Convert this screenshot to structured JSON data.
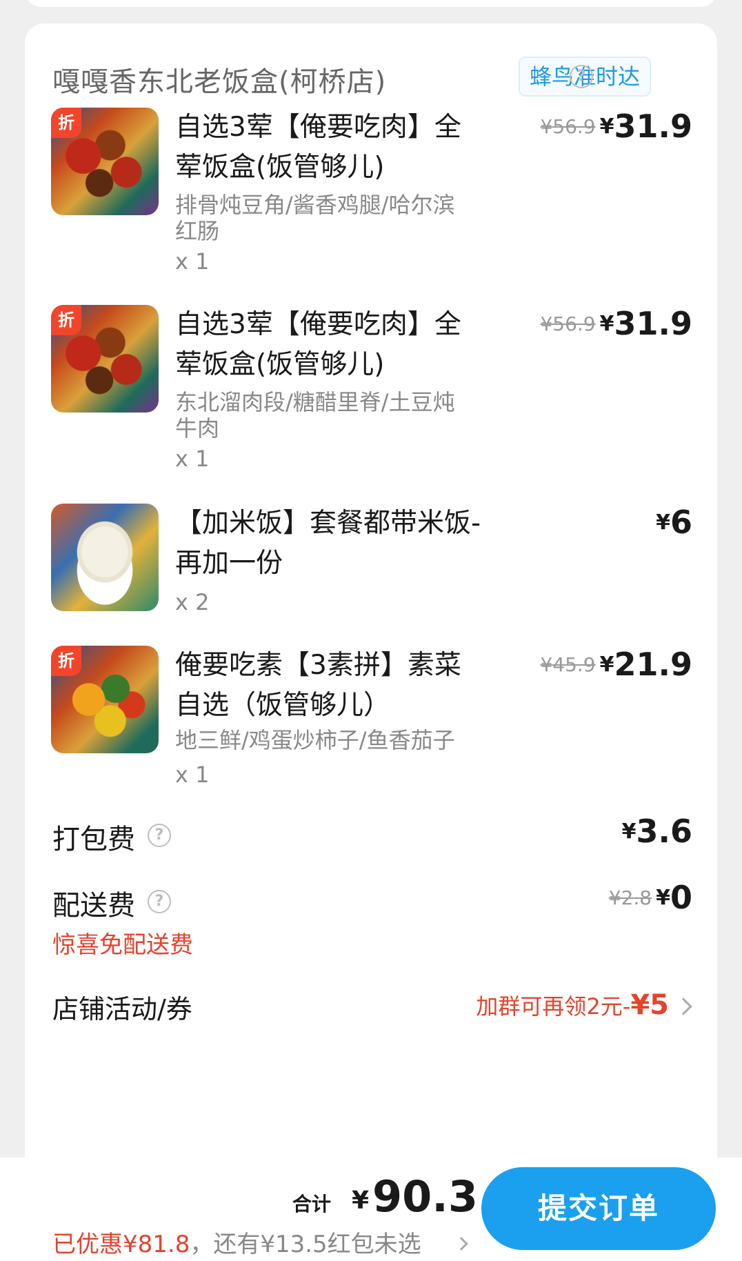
{
  "shop": {
    "name": "嘎嘎香东北老饭盒(柯桥店)",
    "delivery_badge": "蜂鸟准时达",
    "help": "?"
  },
  "items": [
    {
      "tag": "折",
      "name": "自选3荤【俺要吃肉】全荤饭盒(饭管够儿)",
      "spec": "排骨炖豆角/酱香鸡腿/哈尔滨红肠",
      "qty": "x 1",
      "orig_price": "¥56.9",
      "currency": "¥",
      "price": "31.9"
    },
    {
      "tag": "折",
      "name": "自选3荤【俺要吃肉】全荤饭盒(饭管够儿)",
      "spec": "东北溜肉段/糖醋里脊/土豆炖牛肉",
      "qty": "x 1",
      "orig_price": "¥56.9",
      "currency": "¥",
      "price": "31.9"
    },
    {
      "tag": "",
      "name": "【加米饭】套餐都带米饭-再加一份",
      "spec": "",
      "qty": "x 2",
      "orig_price": "",
      "currency": "¥",
      "price": "6"
    },
    {
      "tag": "折",
      "name": "俺要吃素【3素拼】素菜自选（饭管够儿）",
      "spec": "地三鲜/鸡蛋炒柿子/鱼香茄子",
      "qty": "x 1",
      "orig_price": "¥45.9",
      "currency": "¥",
      "price": "21.9"
    }
  ],
  "fees": {
    "packing_label": "打包费",
    "packing_currency": "¥",
    "packing_value": "3.6",
    "delivery_label": "配送费",
    "delivery_orig": "¥2.8",
    "delivery_currency": "¥",
    "delivery_value": "0",
    "delivery_promo": "惊喜免配送费"
  },
  "store_activity": {
    "label": "店铺活动/券",
    "value_text": "加群可再领2元-",
    "amount": "¥5"
  },
  "footer": {
    "total_label": "合计",
    "total_currency": "¥",
    "total_value": "90.3",
    "saved_text": "已优惠¥81.8",
    "separator": "，",
    "redpacket_text": "还有¥13.5红包未选",
    "submit_label": "提交订单"
  },
  "colors": {
    "accent_blue": "#1aa0ee",
    "promo_red": "#e5432c",
    "discount_tag": "#f2452b"
  }
}
